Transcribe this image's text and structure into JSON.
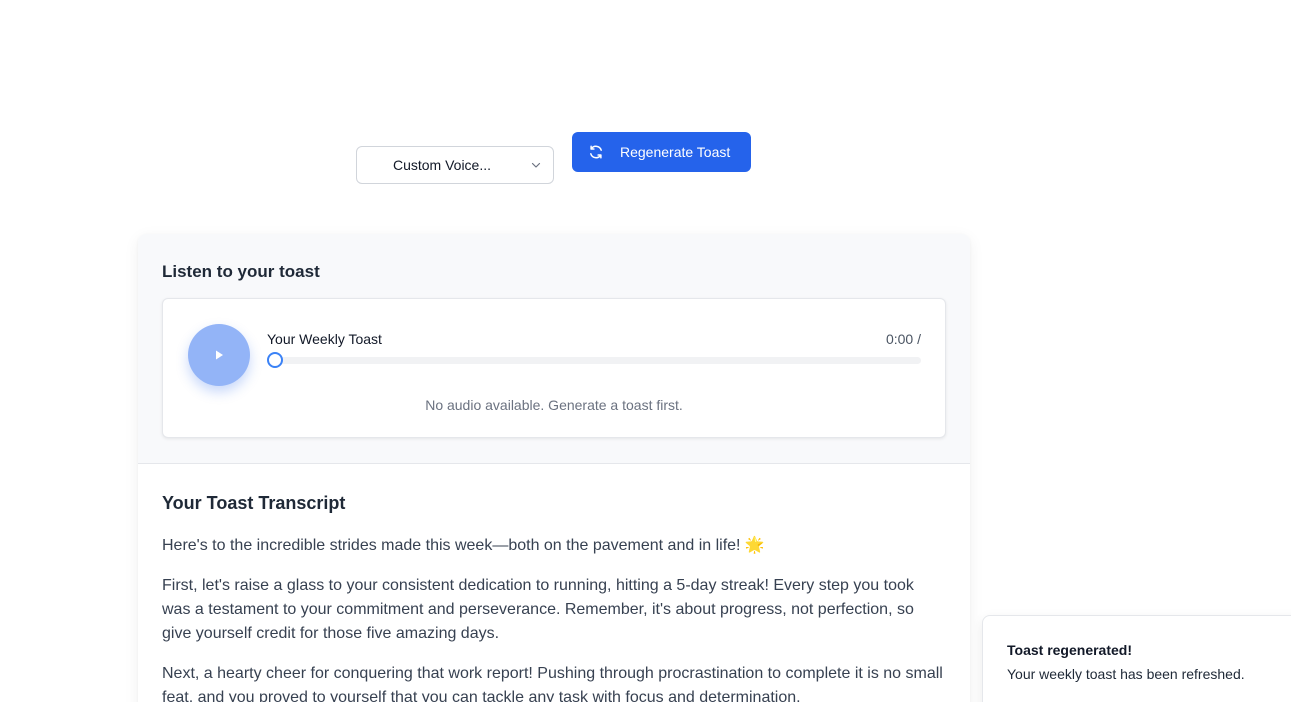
{
  "controls": {
    "voice_select_value": "Custom Voice...",
    "regenerate_label": "Regenerate Toast"
  },
  "listen": {
    "title": "Listen to your toast",
    "track_title": "Your Weekly Toast",
    "time": "0:00 /",
    "progress": 0,
    "empty_message": "No audio available. Generate a toast first."
  },
  "transcript": {
    "title": "Your Toast Transcript",
    "paragraphs": [
      "Here's to the incredible strides made this week—both on the pavement and in life! 🌟",
      "First, let's raise a glass to your consistent dedication to running, hitting a 5-day streak! Every step you took was a testament to your commitment and perseverance. Remember, it's about progress, not perfection, so give yourself credit for those five amazing days.",
      "Next, a hearty cheer for conquering that work report! Pushing through procrastination to complete it is no small feat, and you proved to yourself that you can tackle any task with focus and determination."
    ]
  },
  "toast": {
    "title": "Toast regenerated!",
    "message": "Your weekly toast has been refreshed."
  },
  "colors": {
    "primary": "#2563eb",
    "play_button": "#93b4f7"
  }
}
